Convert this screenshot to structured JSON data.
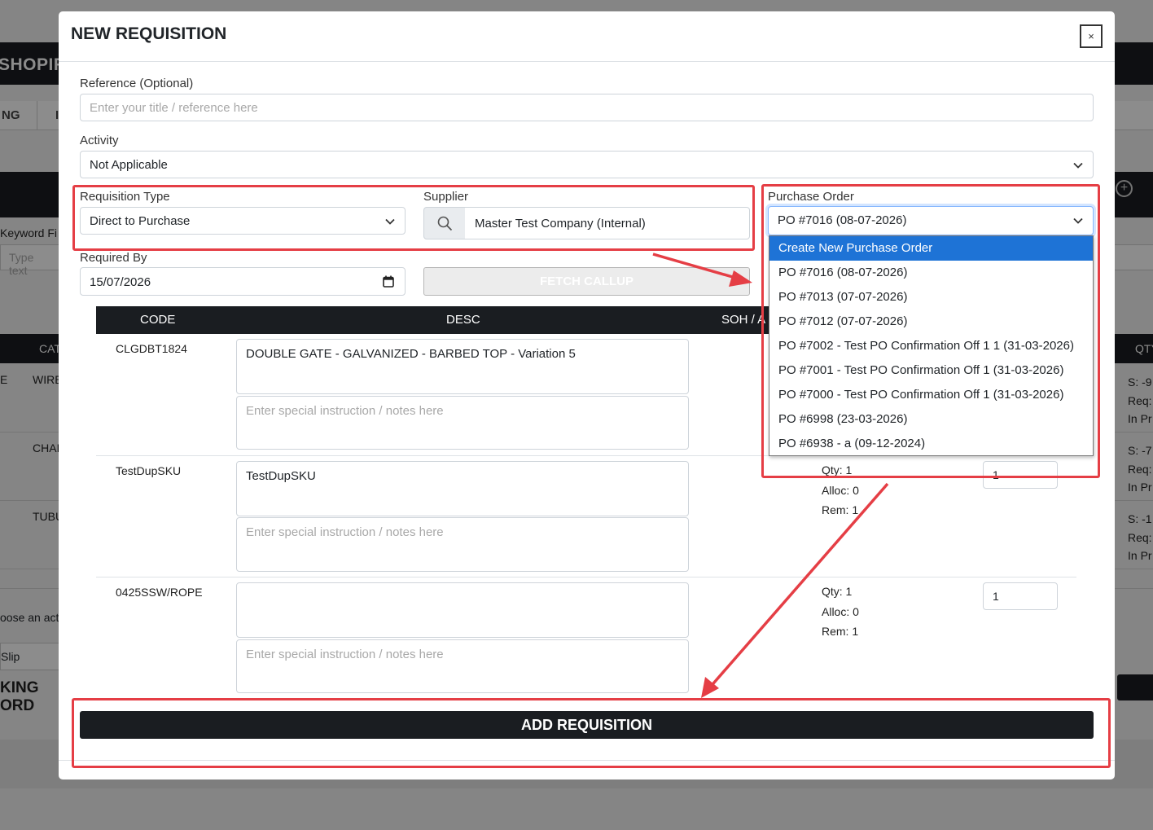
{
  "background": {
    "brand": "SHOPIFY",
    "nav_tabs": [
      "NG",
      "I"
    ],
    "keyword_label": "Keyword Fi",
    "keyword_placeholder": "Type text",
    "table_headers": [
      "CAT",
      "QTY"
    ],
    "rows": [
      {
        "left": "E",
        "cat": "WIRE",
        "qty_lines": [
          "S: -9",
          "Req:",
          "In Pr"
        ]
      },
      {
        "left": "",
        "cat": "CHAI",
        "qty_lines": [
          "S: -7",
          "Req:",
          "In Pr"
        ]
      },
      {
        "left": "",
        "cat": "TUBU",
        "qty_lines": [
          "S: -1",
          "Req:",
          "In Pr"
        ]
      }
    ],
    "choose_action": "oose an acti",
    "slip": "Slip",
    "kingord": "KING ORD"
  },
  "modal": {
    "title": "NEW REQUISITION",
    "close_label": "×",
    "reference_label": "Reference (Optional)",
    "reference_placeholder": "Enter your title / reference here",
    "activity_label": "Activity",
    "activity_value": "Not Applicable",
    "requisition_type_label": "Requisition Type",
    "requisition_type_value": "Direct to Purchase",
    "supplier_label": "Supplier",
    "supplier_value": "Master Test Company (Internal)",
    "purchase_order_label": "Purchase Order",
    "purchase_order_value": "PO #7016 (08-07-2026)",
    "required_by_label": "Required By",
    "required_by_value": "15/07/2026",
    "fetch_callup_label": "FETCH CALLUP",
    "table_headers": {
      "code": "CODE",
      "desc": "DESC",
      "soh": "SOH / A"
    },
    "notes_placeholder": "Enter special instruction / notes here",
    "items": [
      {
        "code": "CLGDBT1824",
        "desc": "DOUBLE GATE - GALVANIZED - BARBED TOP - Variation 5",
        "qty": "",
        "alloc": "",
        "rem": "",
        "input": ""
      },
      {
        "code": "TestDupSKU",
        "desc": "TestDupSKU",
        "qty": "Qty: 1",
        "alloc": "Alloc: 0",
        "rem": "Rem: 1",
        "input": "1"
      },
      {
        "code": "0425SSW/ROPE",
        "desc": "",
        "qty": "Qty: 1",
        "alloc": "Alloc: 0",
        "rem": "Rem: 1",
        "input": "1"
      }
    ],
    "add_button_label": "ADD REQUISITION"
  },
  "purchase_order_options": [
    "Create New Purchase Order",
    "PO #7016 (08-07-2026)",
    "PO #7013 (07-07-2026)",
    "PO #7012 (07-07-2026)",
    "PO #7002 - Test PO Confirmation Off 1 1 (31-03-2026)",
    "PO #7001 - Test PO Confirmation Off 1 (31-03-2026)",
    "PO #7000 - Test PO Confirmation Off 1 (31-03-2026)",
    "PO #6998 (23-03-2026)",
    "PO #6938 - a (09-12-2024)"
  ],
  "colors": {
    "accent": "#1e73d6",
    "dark": "#1a1d21",
    "annotation": "#e53e45"
  }
}
